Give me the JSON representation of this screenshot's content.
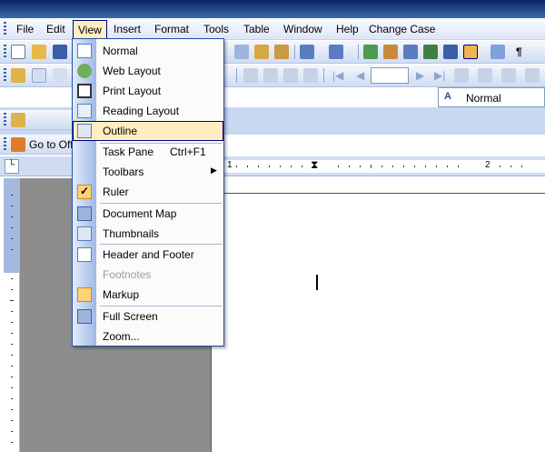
{
  "menubar": {
    "items": [
      "File",
      "Edit",
      "View",
      "Insert",
      "Format",
      "Tools",
      "Table",
      "Window",
      "Help",
      "Change Case"
    ]
  },
  "toolbar": {
    "style_value": "Normal",
    "go_to_label": "Go to Off"
  },
  "view_menu": {
    "items": [
      {
        "label": "Normal",
        "icon": "normal-view-icon"
      },
      {
        "label": "Web Layout",
        "icon": "web-layout-icon"
      },
      {
        "label": "Print Layout",
        "icon": "print-layout-icon"
      },
      {
        "label": "Reading Layout",
        "icon": "reading-layout-icon"
      },
      {
        "label": "Outline",
        "icon": "outline-view-icon"
      },
      {
        "label": "Task Pane",
        "shortcut": "Ctrl+F1"
      },
      {
        "label": "Toolbars",
        "submenu": true
      },
      {
        "label": "Ruler",
        "icon": "checkmark-icon",
        "checked": true
      },
      {
        "label": "Document Map",
        "icon": "document-map-icon"
      },
      {
        "label": "Thumbnails",
        "icon": "thumbnails-icon"
      },
      {
        "label": "Header and Footer",
        "icon": "header-footer-icon"
      },
      {
        "label": "Footnotes",
        "disabled": true
      },
      {
        "label": "Markup",
        "icon": "markup-icon"
      },
      {
        "label": "Full Screen",
        "icon": "full-screen-icon"
      },
      {
        "label": "Zoom..."
      }
    ]
  },
  "ruler": {
    "numbers": [
      "1",
      "2"
    ]
  },
  "colors": {
    "highlight": "#ffeec2",
    "menu_border": "#000080",
    "toolbar_blue": "#cfdcf3"
  }
}
